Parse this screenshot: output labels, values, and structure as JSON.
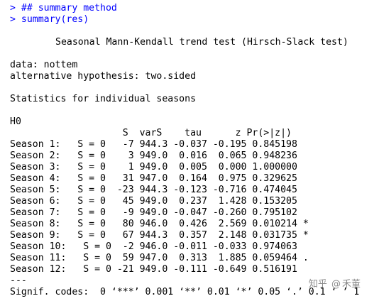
{
  "console": {
    "commands": [
      "> ## summary method",
      "> summary(res)"
    ],
    "title": "Seasonal Mann-Kendall trend test (Hirsch-Slack test)",
    "data_line": "data: nottem",
    "alt_line": "alternative hypothesis: two.sided",
    "stats_heading": "Statistics for individual seasons",
    "hypothesis": "H0",
    "table_header": "                    S  varS    tau      z Pr(>|z|)",
    "rows": [
      "Season 1:   S = 0   -7 944.3 -0.037 -0.195 0.845198  ",
      "Season 2:   S = 0    3 949.0  0.016  0.065 0.948236  ",
      "Season 3:   S = 0    1 949.0  0.005  0.000 1.000000  ",
      "Season 4:   S = 0   31 947.0  0.164  0.975 0.329625  ",
      "Season 5:   S = 0  -23 944.3 -0.123 -0.716 0.474045  ",
      "Season 6:   S = 0   45 949.0  0.237  1.428 0.153205  ",
      "Season 7:   S = 0   -9 949.0 -0.047 -0.260 0.795102  ",
      "Season 8:   S = 0   80 946.0  0.426  2.569 0.010214 *",
      "Season 9:   S = 0   67 944.3  0.357  2.148 0.031735 *",
      "Season 10:   S = 0  -2 946.0 -0.011 -0.033 0.974063  ",
      "Season 11:   S = 0  59 947.0  0.313  1.885 0.059464 .",
      "Season 12:   S = 0 -21 949.0 -0.111 -0.649 0.516191  "
    ],
    "separator": "---",
    "signif": "Signif. codes:  0 ‘***’ 0.001 ‘**’ 0.01 ‘*’ 0.05 ‘.’ 0.1 ‘ ’ 1"
  },
  "watermark": {
    "site": "知乎",
    "at": "@",
    "author": "禾董"
  },
  "colors": {
    "command": "#0000ff",
    "output": "#000000",
    "background": "#ffffff"
  }
}
